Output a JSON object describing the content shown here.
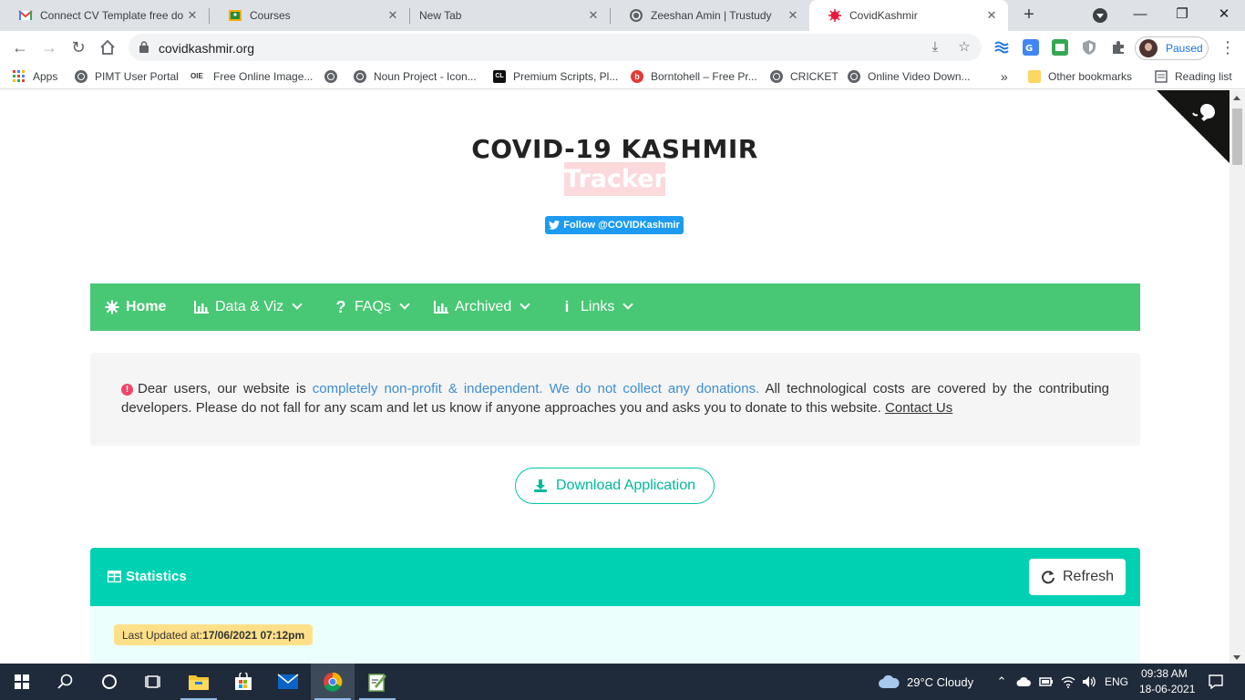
{
  "browser": {
    "tabs": [
      {
        "title": "Connect CV Template free do",
        "favicon": "gmail-icon",
        "active": false
      },
      {
        "title": "Courses",
        "favicon": "classroom-icon",
        "active": false
      },
      {
        "title": "New Tab",
        "favicon": "none",
        "active": false
      },
      {
        "title": "Zeeshan Amin | Trustudy",
        "favicon": "globe-icon",
        "active": false
      },
      {
        "title": "CovidKashmir",
        "favicon": "virus-icon",
        "active": true
      }
    ],
    "new_tab": "+",
    "url": "covidkashmir.org",
    "profile_label": "Paused"
  },
  "bookmarks": [
    {
      "label": "Apps",
      "icon": "apps-grid-icon"
    },
    {
      "label": "PIMT User Portal",
      "icon": "globe-icon"
    },
    {
      "label": "Free Online Image...",
      "icon": "oie-icon"
    },
    {
      "label": "",
      "icon": "globe-icon"
    },
    {
      "label": "Noun Project - Icon...",
      "icon": "globe-icon"
    },
    {
      "label": "Premium Scripts, Pl...",
      "icon": "cl-icon"
    },
    {
      "label": "Borntohell – Free Pr...",
      "icon": "b-icon"
    },
    {
      "label": "CRICKET",
      "icon": "globe-icon"
    },
    {
      "label": "Online Video Down...",
      "icon": "globe-icon"
    }
  ],
  "bookmarks_overflow": "»",
  "other_bookmarks": "Other bookmarks",
  "reading_list": "Reading list",
  "page": {
    "title": "COVID-19 KASHMIR",
    "subtitle": "Tracker",
    "follow_button": "Follow @COVIDKashmir",
    "nav": [
      {
        "label": "Home",
        "icon": "virus-icon",
        "dropdown": false
      },
      {
        "label": "Data & Viz",
        "icon": "chart-icon",
        "dropdown": true
      },
      {
        "label": "FAQs",
        "icon": "question-icon",
        "dropdown": true
      },
      {
        "label": "Archived",
        "icon": "chart-icon",
        "dropdown": true
      },
      {
        "label": "Links",
        "icon": "info-icon",
        "dropdown": true
      }
    ],
    "notice": {
      "before": "Dear users, our website is ",
      "highlight": "completely non-profit & independent. We do not collect any donations.",
      "after": " All technological costs are covered by the contributing developers. Please do not fall for any scam and let us know if anyone approaches you and asks you to donate to this website. ",
      "link": "Contact Us"
    },
    "download_button": "Download Application",
    "stats": {
      "title": "Statistics",
      "refresh": "Refresh",
      "last_updated_label": "Last Updated at:",
      "last_updated_value": "17/06/2021 07:12pm"
    }
  },
  "taskbar": {
    "weather": "29°C  Cloudy",
    "language": "ENG",
    "time": "09:38 AM",
    "date": "18-06-2021"
  },
  "colors": {
    "nav_green": "#48c774",
    "stats_teal": "#00d1b2",
    "twitter_blue": "#1d9bf0",
    "notice_link": "#3e8ed0",
    "badge_yellow": "#ffe08a",
    "taskbar": "#1f2b3a"
  }
}
